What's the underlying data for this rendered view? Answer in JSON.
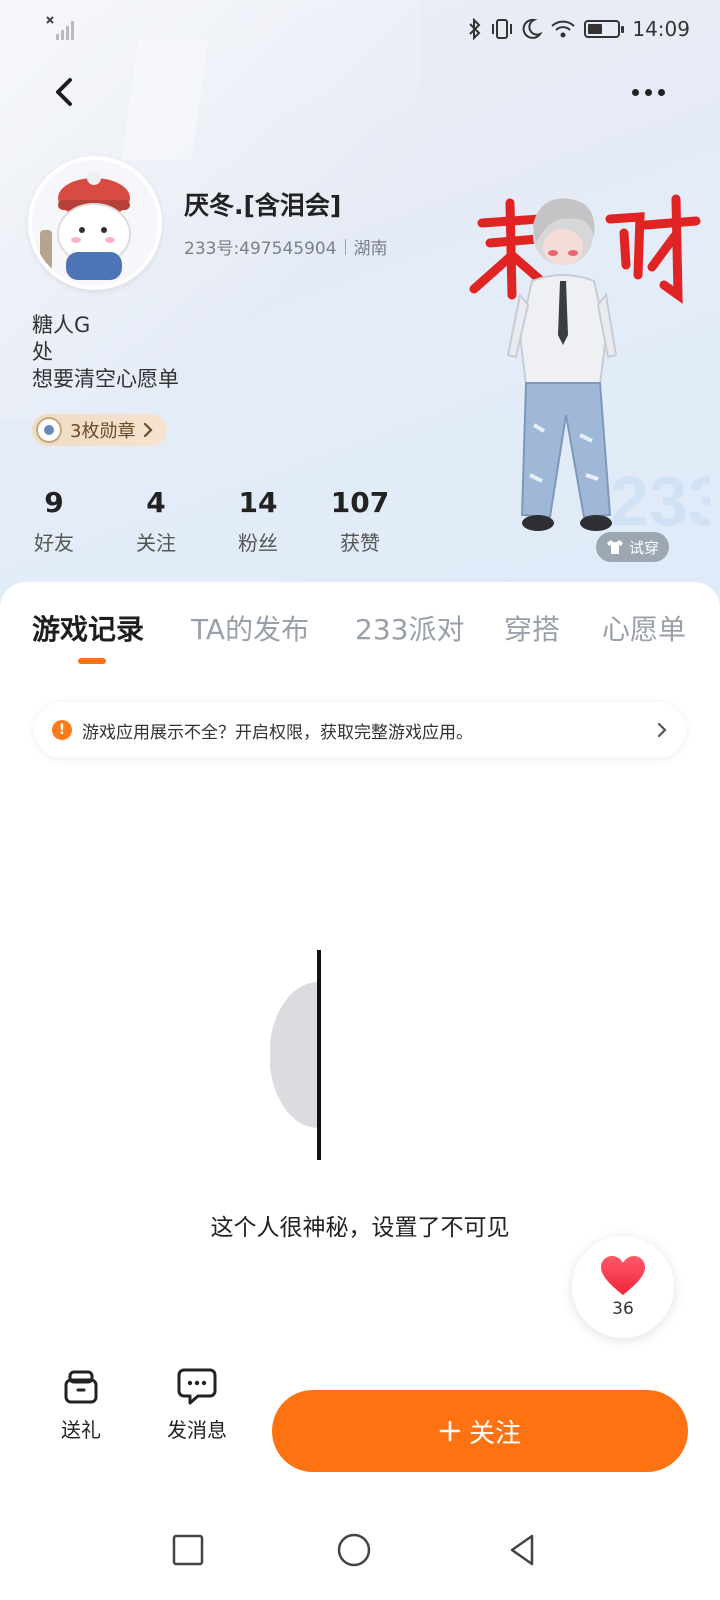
{
  "status_bar": {
    "time": "14:09",
    "icons": [
      "signal-off-icon",
      "bluetooth-icon",
      "vibrate-icon",
      "moon-icon",
      "wifi-icon",
      "battery-icon"
    ]
  },
  "nav": {
    "back_icon": "chevron-left-icon",
    "more_icon": "more-dots-icon"
  },
  "profile": {
    "nickname": "厌冬.[含泪会]",
    "id_text": "233号:497545904",
    "location": "湖南",
    "bio": [
      "糖人G",
      "处",
      "想要清空心愿单"
    ],
    "badge_label": "3枚勋章",
    "stats": [
      {
        "value": "9",
        "label": "好友"
      },
      {
        "value": "4",
        "label": "关注"
      },
      {
        "value": "14",
        "label": "粉丝"
      },
      {
        "value": "107",
        "label": "获赞"
      }
    ],
    "avatar_text_banner": "来财",
    "try_on_label": "试穿"
  },
  "tabs": [
    {
      "label": "游戏记录",
      "active": true
    },
    {
      "label": "TA的发布",
      "active": false
    },
    {
      "label": "233派对",
      "active": false
    },
    {
      "label": "穿搭",
      "active": false
    },
    {
      "label": "心愿单",
      "active": false
    }
  ],
  "notice": {
    "text": "游戏应用展示不全？开启权限，获取完整游戏应用。"
  },
  "empty_state": {
    "text": "这个人很神秘，设置了不可见"
  },
  "like": {
    "count": "36"
  },
  "actions": {
    "gift_label": "送礼",
    "message_label": "发消息",
    "follow_label": "关注"
  },
  "colors": {
    "accent": "#ff7212",
    "tab_active": "#1e1e1e",
    "tab_inactive": "#9aa0aa",
    "banner_red": "#e02424"
  }
}
